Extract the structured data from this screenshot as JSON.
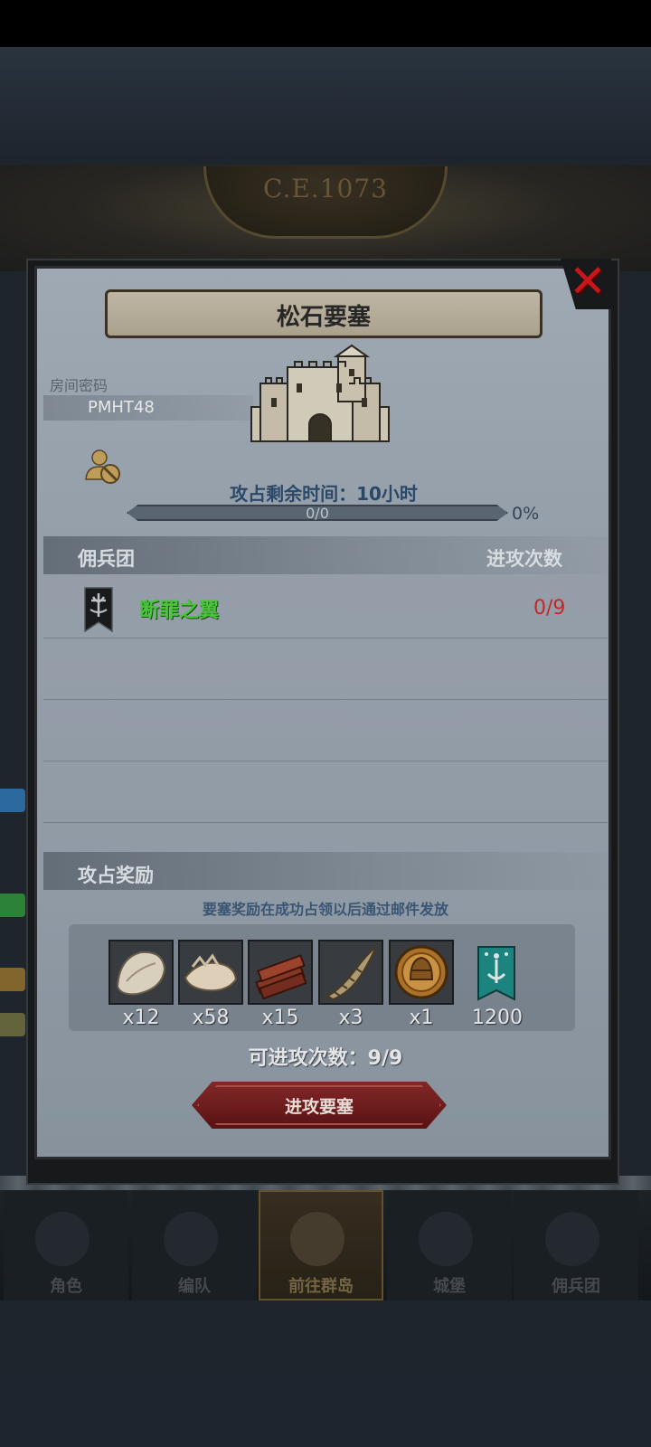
{
  "background": {
    "era": "C.E.1073"
  },
  "modal": {
    "title": "松石要塞",
    "close_icon": "close-x-icon",
    "room_label": "房间密码",
    "room_code": "PMHT48",
    "timer_text": "攻占剩余时间：10小时",
    "progress": {
      "text": "0/0",
      "percent_text": "0%",
      "fraction": 0
    },
    "guild_section": {
      "header": "佣兵团",
      "attacks_header": "进攻次数",
      "rows": [
        {
          "name": "断罪之翼",
          "count": "0/9"
        }
      ]
    },
    "reward_section": {
      "header": "攻占奖励",
      "note": "要塞奖励在成功占领以后通过邮件发放",
      "items": [
        {
          "icon": "hide-pelt-icon",
          "count": "x12"
        },
        {
          "icon": "fur-bundle-icon",
          "count": "x58"
        },
        {
          "icon": "wood-planks-icon",
          "count": "x15"
        },
        {
          "icon": "horn-icon",
          "count": "x3"
        },
        {
          "icon": "helmet-medal-icon",
          "count": "x1"
        },
        {
          "icon": "guild-banner-icon",
          "count": "1200"
        }
      ]
    },
    "attacks_left": "可进攻次数：9/9",
    "attack_button": "进攻要塞"
  },
  "bottom_nav": [
    {
      "label": "角色",
      "icon": "knight-icon",
      "active": false
    },
    {
      "label": "编队",
      "icon": "formation-icon",
      "active": false
    },
    {
      "label": "前往群岛",
      "icon": "compass-map-icon",
      "active": true
    },
    {
      "label": "城堡",
      "icon": "castle-icon",
      "active": false
    },
    {
      "label": "佣兵团",
      "icon": "mercenary-flag-icon",
      "active": false
    }
  ],
  "colors": {
    "guild_name": "#4bd13e",
    "guild_count": "#cf2a2a",
    "close_red": "#d3181b",
    "button_red": "#8a2a2a"
  }
}
